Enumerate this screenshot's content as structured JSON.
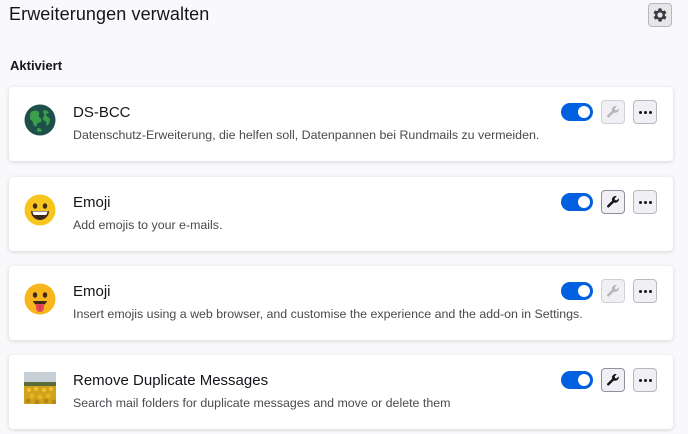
{
  "header": {
    "title": "Erweiterungen verwalten",
    "settings_icon": "gear-icon"
  },
  "section": {
    "title": "Aktiviert"
  },
  "extensions": [
    {
      "name": "DS-BCC",
      "description": "Datenschutz-Erweiterung, die helfen soll, Datenpannen bei Rundmails zu vermeiden.",
      "icon": "globe-icon",
      "enabled": true,
      "options_available": false
    },
    {
      "name": "Emoji",
      "description": "Add emojis to your e-mails.",
      "icon": "grinning-emoji-icon",
      "enabled": true,
      "options_available": true
    },
    {
      "name": "Emoji",
      "description": "Insert emojis using a web browser, and customise the experience and the add-on in Settings.",
      "icon": "tongue-emoji-icon",
      "enabled": true,
      "options_available": false
    },
    {
      "name": "Remove Duplicate Messages",
      "description": "Search mail folders for duplicate messages and move or delete them",
      "icon": "sunflower-field-icon",
      "enabled": true,
      "options_available": true
    }
  ],
  "colors": {
    "toggle_on": "#0060df",
    "background": "#f9f9fb",
    "card": "#ffffff"
  }
}
